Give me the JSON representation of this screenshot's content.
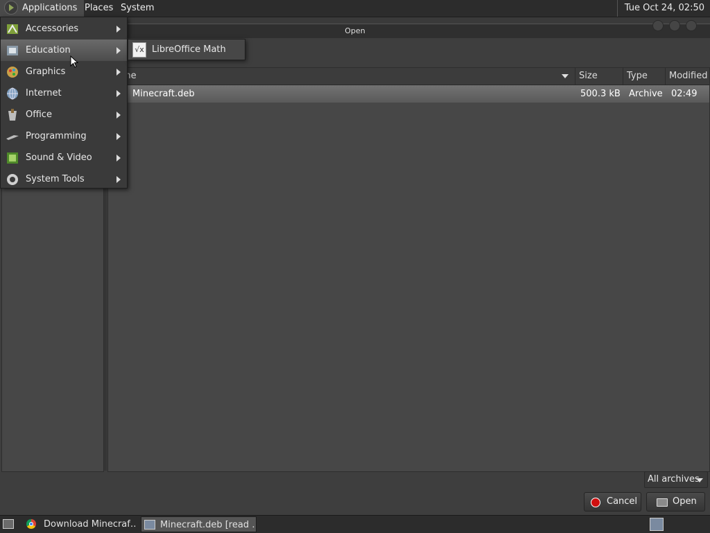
{
  "top_panel": {
    "menus": [
      "Applications",
      "Places",
      "System"
    ],
    "clock": "Tue Oct 24, 02:50"
  },
  "apps_menu": {
    "items": [
      {
        "label": "Accessories",
        "icon": "accessories-icon"
      },
      {
        "label": "Education",
        "icon": "education-icon",
        "active": true
      },
      {
        "label": "Graphics",
        "icon": "graphics-icon"
      },
      {
        "label": "Internet",
        "icon": "internet-icon"
      },
      {
        "label": "Office",
        "icon": "office-icon"
      },
      {
        "label": "Programming",
        "icon": "programming-icon"
      },
      {
        "label": "Sound & Video",
        "icon": "sound-video-icon"
      },
      {
        "label": "System Tools",
        "icon": "system-tools-icon"
      }
    ],
    "submenu": {
      "label": "LibreOffice Math",
      "icon": "libreoffice-math-icon",
      "icon_glyph": "√x"
    }
  },
  "dialog": {
    "title": "Open",
    "columns": {
      "name": "Name",
      "name_visible": "me",
      "size": "Size",
      "type": "Type",
      "modified": "Modified"
    },
    "files": [
      {
        "name": "Minecraft.deb",
        "size": "500.3 kB",
        "type": "Archive",
        "modified": "02:49",
        "selected": true
      }
    ],
    "filter": "All archives",
    "cancel_label": "Cancel",
    "open_label": "Open"
  },
  "taskbar": {
    "tasks": [
      {
        "label": "Download Minecraf…",
        "icon": "chrome-icon"
      },
      {
        "label": "Minecraft.deb [read …",
        "icon": "archive-manager-icon",
        "active": true
      }
    ]
  },
  "colors": {
    "panel_bg": "#2c2c2c",
    "dialog_bg": "#3e3e3e",
    "list_bg": "#474747",
    "selection": "#6a6a6a",
    "cancel_icon": "#d01010"
  }
}
